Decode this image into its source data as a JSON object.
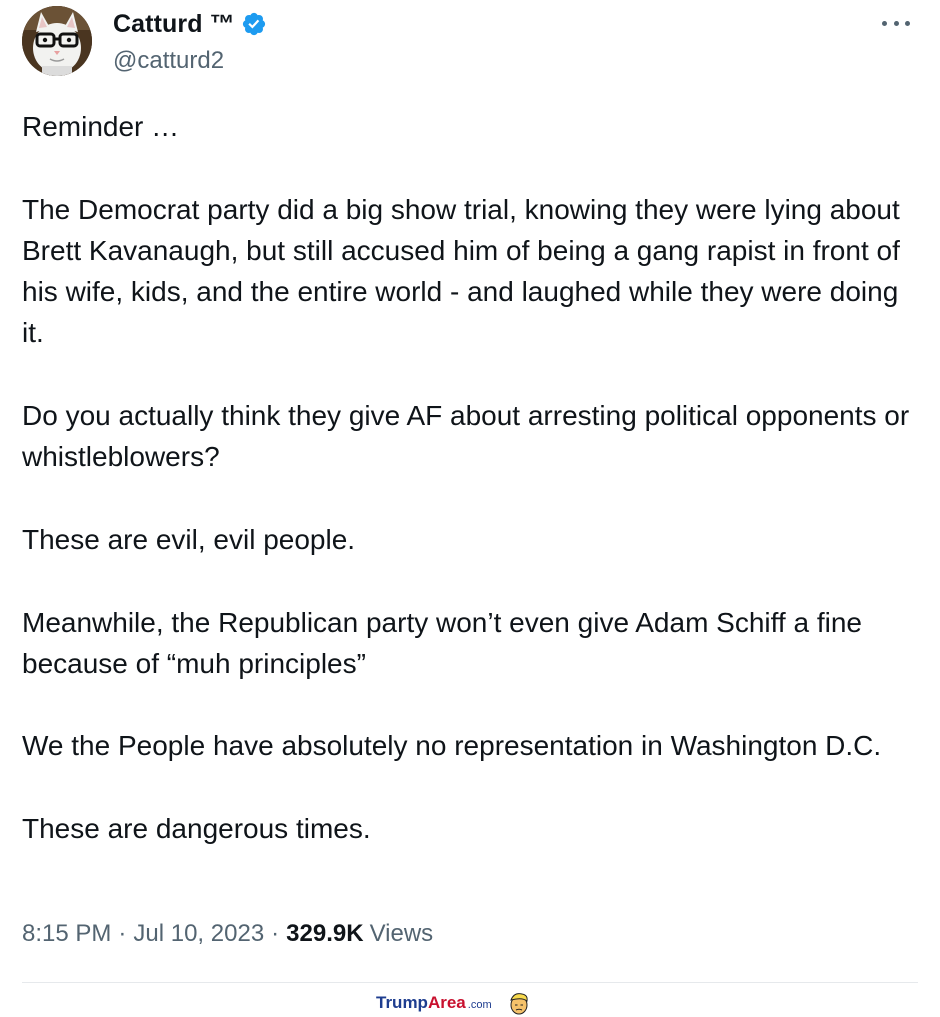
{
  "tweet": {
    "author": {
      "display_name": "Catturd ™",
      "handle": "@catturd2",
      "verified": true,
      "avatar_icon": "cat-with-glasses-avatar"
    },
    "more_icon": "more-options-icon",
    "paragraphs": [
      "Reminder …",
      "The Democrat party did a big show trial, knowing they were lying about Brett Kavanaugh, but still accused him of being a gang rapist in front of his wife, kids, and the entire world - and laughed while they were doing it.",
      "Do you actually think they give AF about arresting political opponents or whistleblowers?",
      "These are evil, evil people.",
      "Meanwhile, the Republican party won’t even give Adam Schiff a fine because of “muh principles”",
      "We the People have absolutely no representation in Washington D.C.",
      "These are dangerous times."
    ],
    "time": "8:15 PM",
    "date": "Jul 10, 2023",
    "separator": "·",
    "views_count": "329.9K",
    "views_label": "Views"
  },
  "watermark": {
    "part1": "Trump",
    "part2": "Area",
    "part3": ".com"
  },
  "colors": {
    "text": "#0f1419",
    "secondary": "#536471",
    "verified_blue": "#1d9bf0",
    "watermark_blue": "#1e3d8f",
    "watermark_red": "#c8102e"
  }
}
